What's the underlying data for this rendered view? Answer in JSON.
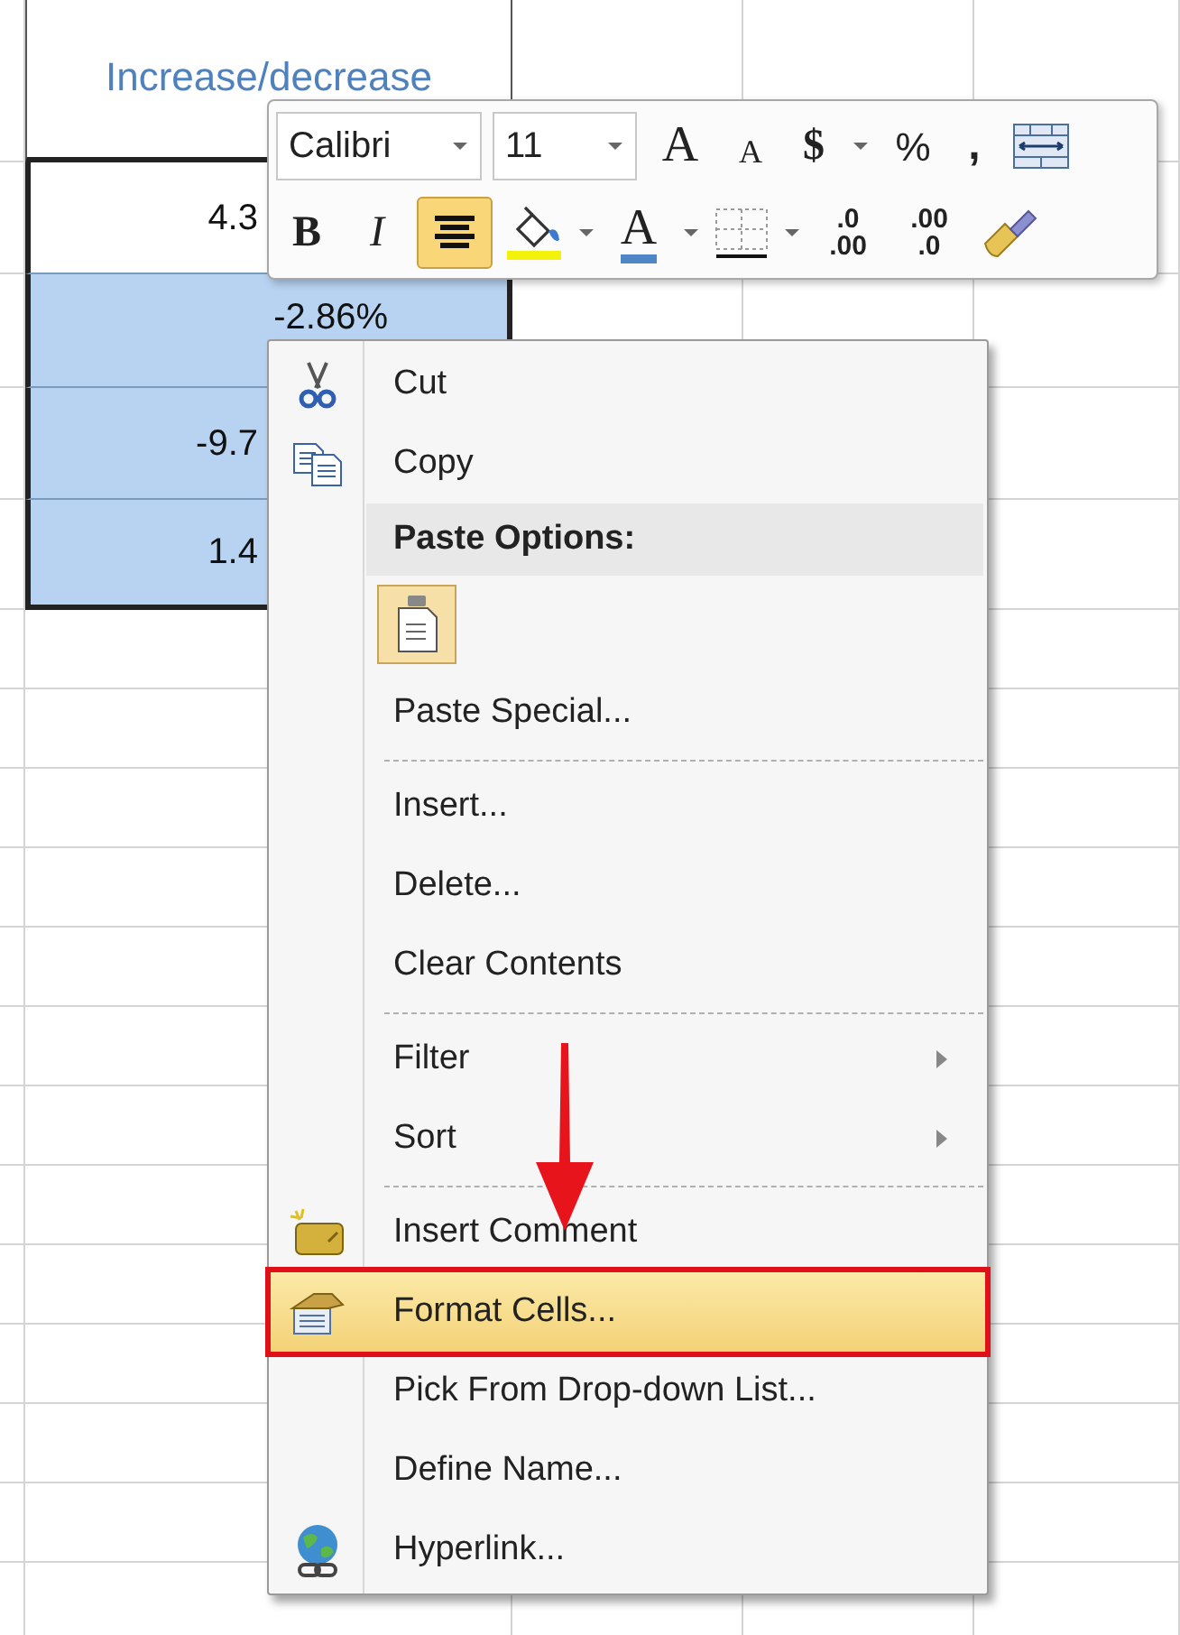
{
  "sheet": {
    "header": "Increase/decrease",
    "cells": [
      {
        "value": "4.3",
        "selected": false
      },
      {
        "value": "-2.86%",
        "selected": true
      },
      {
        "value": "-9.7",
        "selected": true
      },
      {
        "value": "1.4",
        "selected": true
      }
    ]
  },
  "toolbar": {
    "lines": [
      {
        "items": [
          {
            "kind": "combo",
            "value": "Calibri"
          },
          {
            "kind": "combo",
            "value": "11"
          },
          {
            "kind": "glyph",
            "label": "A",
            "dropdown": false,
            "selected": false
          },
          {
            "kind": "glyph",
            "label": "A",
            "dropdown": false,
            "selected": false
          },
          {
            "kind": "glyph",
            "label": "$",
            "dropdown": true,
            "selected": false
          },
          {
            "kind": "glyph",
            "label": "%",
            "dropdown": false,
            "selected": false
          },
          {
            "kind": "glyph",
            "label": ",",
            "dropdown": false,
            "selected": false
          },
          {
            "kind": "icon",
            "dropdown": false,
            "selected": false
          }
        ]
      },
      {
        "items": [
          {
            "kind": "glyph",
            "label": "B",
            "dropdown": false,
            "selected": false
          },
          {
            "kind": "glyph",
            "label": "I",
            "dropdown": false,
            "selected": false
          },
          {
            "kind": "icon",
            "dropdown": false,
            "selected": true
          },
          {
            "kind": "icon",
            "dropdown": true,
            "selected": false
          },
          {
            "kind": "glyph",
            "label": "A",
            "dropdown": true,
            "selected": false
          },
          {
            "kind": "icon",
            "dropdown": true,
            "selected": false
          },
          {
            "kind": "decimal",
            "top": ".0",
            "bottom": ".00",
            "dropdown": false,
            "selected": false
          },
          {
            "kind": "decimal",
            "top": ".00",
            "bottom": ".0",
            "dropdown": false,
            "selected": false
          },
          {
            "kind": "icon",
            "dropdown": false,
            "selected": false
          }
        ]
      }
    ]
  },
  "menu": {
    "items": [
      {
        "kind": "command",
        "label": "Cut",
        "submenu": false,
        "selected": false,
        "annotated": false
      },
      {
        "kind": "command",
        "label": "Copy",
        "submenu": false,
        "selected": false,
        "annotated": false
      },
      {
        "kind": "header",
        "label": "Paste Options:"
      },
      {
        "kind": "paste_buttons"
      },
      {
        "kind": "command",
        "label": "Paste Special...",
        "submenu": false,
        "selected": false,
        "annotated": false
      },
      {
        "kind": "separator"
      },
      {
        "kind": "command",
        "label": "Insert...",
        "submenu": false,
        "selected": false,
        "annotated": false
      },
      {
        "kind": "command",
        "label": "Delete...",
        "submenu": false,
        "selected": false,
        "annotated": false
      },
      {
        "kind": "command",
        "label": "Clear Contents",
        "submenu": false,
        "selected": false,
        "annotated": false
      },
      {
        "kind": "separator"
      },
      {
        "kind": "command",
        "label": "Filter",
        "submenu": true,
        "selected": false,
        "annotated": false
      },
      {
        "kind": "command",
        "label": "Sort",
        "submenu": true,
        "selected": false,
        "annotated": false
      },
      {
        "kind": "separator"
      },
      {
        "kind": "command",
        "label": "Insert Comment",
        "submenu": false,
        "selected": false,
        "annotated": false
      },
      {
        "kind": "command",
        "label": "Format Cells...",
        "submenu": false,
        "selected": true,
        "annotated": true
      },
      {
        "kind": "command",
        "label": "Pick From Drop-down List...",
        "submenu": false,
        "selected": false,
        "annotated": false
      },
      {
        "kind": "command",
        "label": "Define Name...",
        "submenu": false,
        "selected": false,
        "annotated": false
      },
      {
        "kind": "command",
        "label": "Hyperlink...",
        "submenu": false,
        "selected": false,
        "annotated": false
      }
    ]
  }
}
